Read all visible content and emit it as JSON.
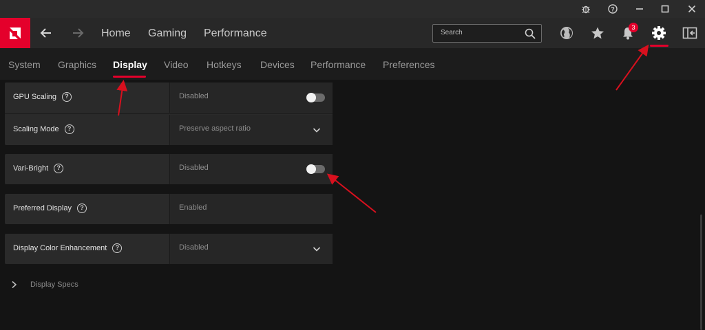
{
  "window": {
    "controls": [
      "bug-report-icon",
      "help-icon",
      "minimize-icon",
      "maximize-icon",
      "close-icon"
    ]
  },
  "topnav": {
    "logo": "amd-logo",
    "links": [
      "Home",
      "Gaming",
      "Performance"
    ],
    "search": {
      "placeholder": "Search"
    },
    "notifications_count": "3",
    "icons": [
      "globe-icon",
      "star-icon",
      "bell-icon",
      "gear-icon",
      "sidebar-toggle-icon"
    ]
  },
  "tabs": [
    {
      "label": "System",
      "active": false
    },
    {
      "label": "Graphics",
      "active": false
    },
    {
      "label": "Display",
      "active": true
    },
    {
      "label": "Video",
      "active": false
    },
    {
      "label": "Hotkeys",
      "active": false
    },
    {
      "label": "Devices",
      "active": false
    },
    {
      "label": "Performance",
      "active": false
    },
    {
      "label": "Preferences",
      "active": false
    }
  ],
  "settings": [
    {
      "label": "GPU Scaling",
      "value": "Disabled",
      "control": "toggle",
      "on": false
    },
    {
      "label": "Scaling Mode",
      "value": "Preserve aspect ratio",
      "control": "dropdown"
    },
    {
      "label": "Vari-Bright",
      "value": "Disabled",
      "control": "toggle",
      "on": false
    },
    {
      "label": "Preferred Display",
      "value": "Enabled",
      "control": "none"
    },
    {
      "label": "Display Color Enhancement",
      "value": "Disabled",
      "control": "dropdown"
    }
  ],
  "specs_label": "Display Specs",
  "colors": {
    "accent": "#e4002b",
    "background": "#141414",
    "card": "#2a2a2a",
    "annotation_arrow": "#d8101e"
  }
}
